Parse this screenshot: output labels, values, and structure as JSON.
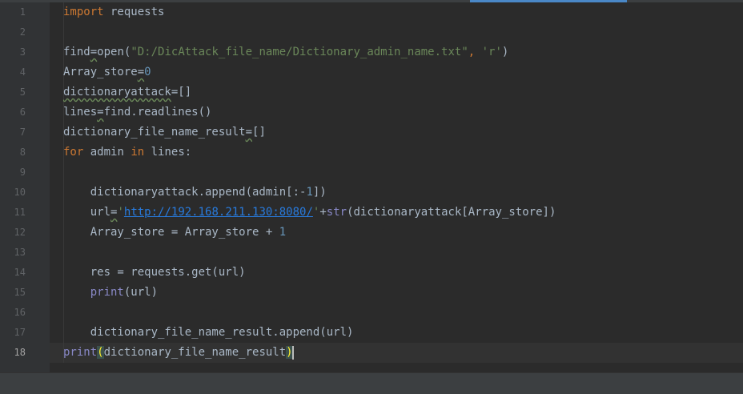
{
  "editor": {
    "line_numbers": [
      "1",
      "2",
      "3",
      "4",
      "5",
      "6",
      "7",
      "8",
      "9",
      "10",
      "11",
      "12",
      "13",
      "14",
      "15",
      "16",
      "17",
      "18"
    ],
    "code": {
      "l1_import": "import",
      "l1_rest": " requests",
      "l3_a": "find",
      "l3_eq": "=",
      "l3_b": "open(",
      "l3_str1": "\"D:/DicAttack_file_name/Dictionary_admin_name.txt\"",
      "l3_comma": ", ",
      "l3_str2": "'r'",
      "l3_close": ")",
      "l4_a": "Array_store",
      "l4_eq": "=",
      "l4_num": "0",
      "l5_a": "dictionaryattack",
      "l5_b": "=[]",
      "l6_a": "lines",
      "l6_eq": "=",
      "l6_b": "find.readlines()",
      "l7_a": "dictionary_file_name_result",
      "l7_eq": "=",
      "l7_b": "[]",
      "l8_for": "for",
      "l8_mid": " admin ",
      "l8_in": "in",
      "l8_rest": " lines:",
      "l10_a": "    dictionaryattack.append(admin[:-",
      "l10_num": "1",
      "l10_b": "])",
      "l11_a": "    url",
      "l11_eq": "=",
      "l11_q1": "'",
      "l11_url": "http://192.168.211.130:8080/",
      "l11_q2": "'",
      "l11_plus": "+",
      "l11_str": "str",
      "l11_b": "(dictionaryattack[Array_store])",
      "l12_a": "    Array_store = Array_store + ",
      "l12_num": "1",
      "l14_a": "    res = requests.get(url)",
      "l15_indent": "    ",
      "l15_print": "print",
      "l15_b": "(url)",
      "l17_a": "    dictionary_file_name_result.append(url)",
      "l18_print": "print",
      "l18_open": "(",
      "l18_mid": "dictionary_file_name_result",
      "l18_close": ")"
    }
  },
  "colors": {
    "background": "#2b2b2b",
    "gutter": "#313335",
    "keyword": "#cc7832",
    "string": "#6a8759",
    "number": "#6897bb",
    "builtin": "#8888c6",
    "text": "#a9b7c6",
    "accent": "#4a88c7"
  }
}
